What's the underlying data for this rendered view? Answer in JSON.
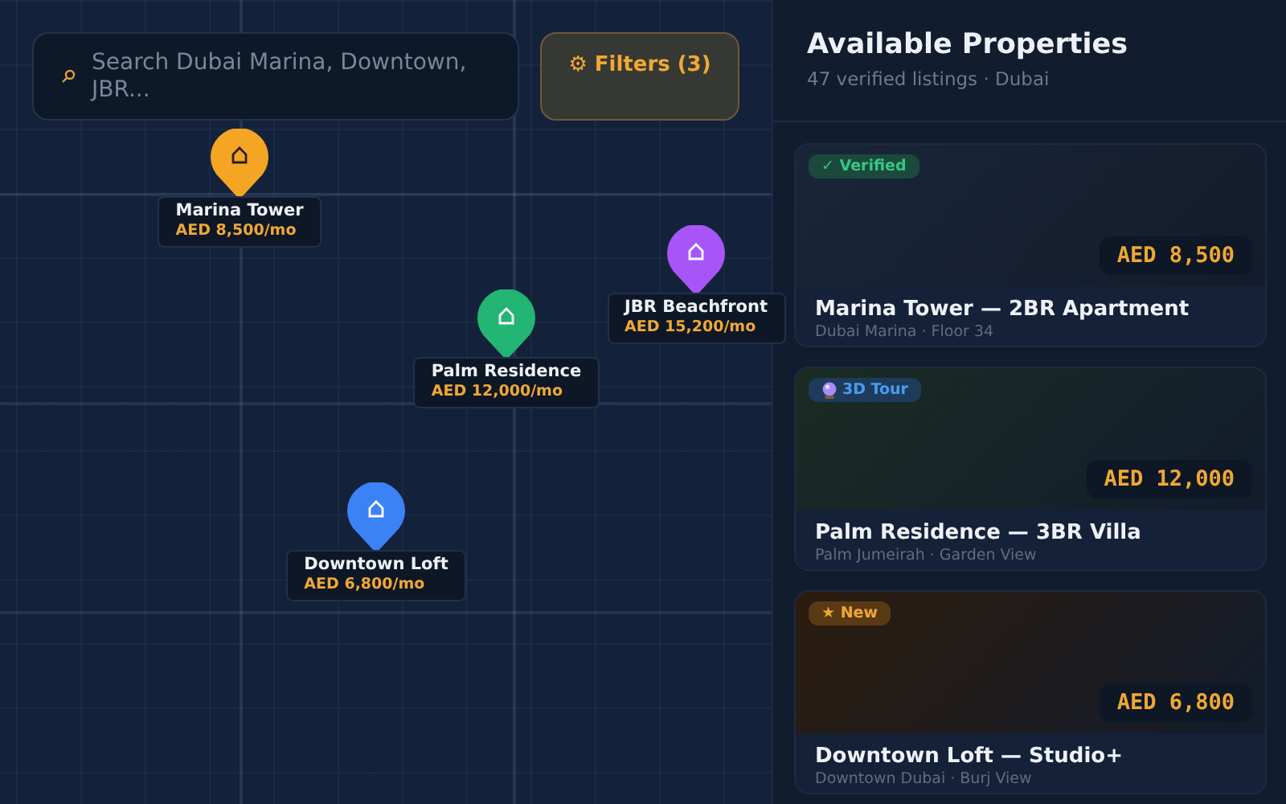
{
  "search": {
    "placeholder": "Search Dubai Marina, Downtown, JBR..."
  },
  "filters_button": {
    "label": "⚙ Filters (3)"
  },
  "map_pins": [
    {
      "name": "Marina Tower",
      "price": "AED 8,500/mo",
      "color": "#f5a524"
    },
    {
      "name": "JBR Beachfront",
      "price": "AED 15,200/mo",
      "color": "#a855f7"
    },
    {
      "name": "Palm Residence",
      "price": "AED 12,000/mo",
      "color": "#22b573"
    },
    {
      "name": "Downtown Loft",
      "price": "AED 6,800/mo",
      "color": "#3b82f6"
    }
  ],
  "panel": {
    "title": "Available Properties",
    "subtitle": "47 verified listings · Dubai"
  },
  "listings": [
    {
      "badge": {
        "kind": "verified",
        "label": "✓ Verified"
      },
      "color": "#1a2538",
      "price": "AED 8,500",
      "title": "Marina Tower — 2BR Apartment",
      "subtitle": "Dubai Marina · Floor 34"
    },
    {
      "badge": {
        "kind": "tour",
        "label": "3D Tour"
      },
      "color": "#1a2c24",
      "price": "AED 12,000",
      "title": "Palm Residence — 3BR Villa",
      "subtitle": "Palm Jumeirah · Garden View"
    },
    {
      "badge": {
        "kind": "new",
        "label": "★ New"
      },
      "color": "#2c1c0e",
      "price": "AED 6,800",
      "title": "Downtown Loft — Studio+",
      "subtitle": "Downtown Dubai · Burj View"
    }
  ]
}
